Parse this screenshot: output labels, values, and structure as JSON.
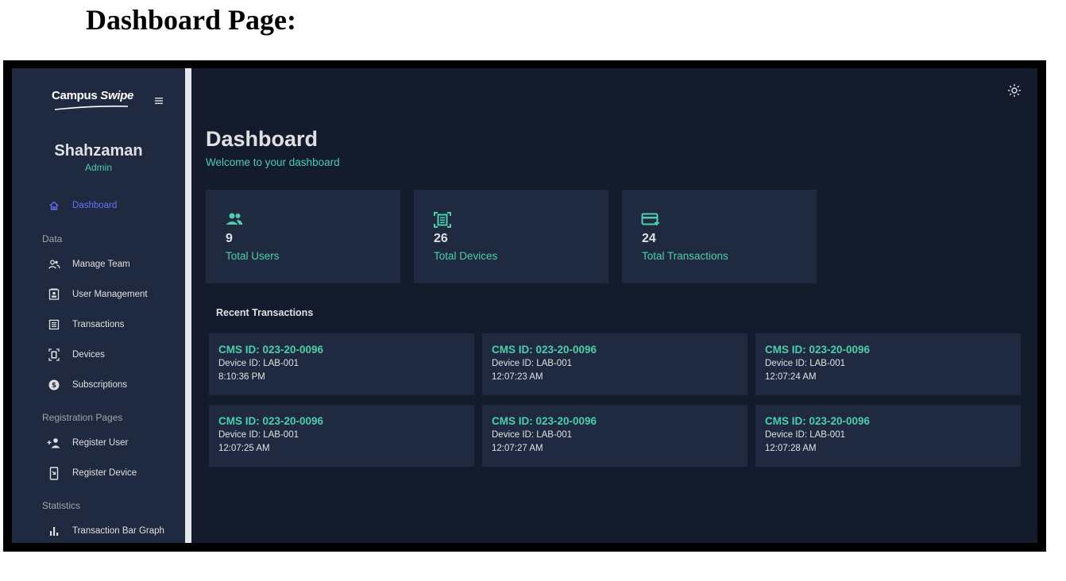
{
  "document": {
    "heading": "Dashboard Page:"
  },
  "app": {
    "brand": {
      "part1": "Campus ",
      "part2": "Swipe"
    },
    "profile": {
      "name": "Shahzaman",
      "role": "Admin"
    },
    "sidebar": {
      "dashboard": "Dashboard",
      "sections": {
        "data": "Data",
        "registration": "Registration Pages",
        "statistics": "Statistics"
      },
      "items": [
        {
          "label": "Manage Team",
          "icon": "people-icon"
        },
        {
          "label": "User Management",
          "icon": "contact-card-icon"
        },
        {
          "label": "Transactions",
          "icon": "receipt-list-icon"
        },
        {
          "label": "Devices",
          "icon": "device-scan-icon"
        },
        {
          "label": "Subscriptions",
          "icon": "dollar-coin-icon"
        },
        {
          "label": "Register User",
          "icon": "person-add-icon"
        },
        {
          "label": "Register Device",
          "icon": "register-device-icon"
        },
        {
          "label": "Transaction Bar Graph",
          "icon": "bar-chart-icon"
        }
      ]
    },
    "header": {
      "theme_icon": "sun-icon"
    },
    "page": {
      "title": "Dashboard",
      "subtitle": "Welcome to your dashboard"
    },
    "stats": [
      {
        "value": "9",
        "label": "Total Users",
        "icon": "people-icon"
      },
      {
        "value": "26",
        "label": "Total Devices",
        "icon": "device-scan-icon"
      },
      {
        "value": "24",
        "label": "Total Transactions",
        "icon": "credit-card-add-icon"
      }
    ],
    "recent": {
      "title": "Recent Transactions",
      "items": [
        {
          "cms": "CMS ID: 023-20-0096",
          "device": "Device ID: LAB-001",
          "time": "8:10:36 PM"
        },
        {
          "cms": "CMS ID: 023-20-0096",
          "device": "Device ID: LAB-001",
          "time": "12:07:23 AM"
        },
        {
          "cms": "CMS ID: 023-20-0096",
          "device": "Device ID: LAB-001",
          "time": "12:07:24 AM"
        },
        {
          "cms": "CMS ID: 023-20-0096",
          "device": "Device ID: LAB-001",
          "time": "12:07:25 AM"
        },
        {
          "cms": "CMS ID: 023-20-0096",
          "device": "Device ID: LAB-001",
          "time": "12:07:27 AM"
        },
        {
          "cms": "CMS ID: 023-20-0096",
          "device": "Device ID: LAB-001",
          "time": "12:07:28 AM"
        }
      ]
    },
    "colors": {
      "background": "#141b2d",
      "panel": "#1f2a40",
      "accent": "#4cceac",
      "active": "#6870fa",
      "text": "#e0e0e0"
    }
  }
}
